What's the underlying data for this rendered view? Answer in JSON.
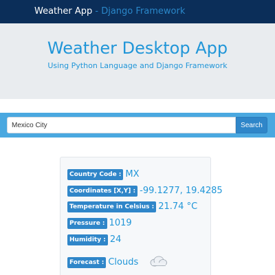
{
  "navbar": {
    "brand_main": "Weather App",
    "brand_sub": " - Django Framework"
  },
  "header": {
    "title": "Weather Desktop App",
    "subtitle": "Using Python Language and Django Framework"
  },
  "search": {
    "value": "Mexico City",
    "button_label": "Search"
  },
  "result": {
    "country_label": "Country Code :",
    "country_value": "MX",
    "coord_label": "Coordinates [X,Y] :",
    "coord_value": "-99.1277, 19.4285",
    "temp_label": "Temperature in Celsius :",
    "temp_value": "21.74 °C",
    "pressure_label": "Pressure :",
    "pressure_value": "1019",
    "humidity_label": "Humidity :",
    "humidity_value": "24",
    "forecast_label": "Forecast :",
    "forecast_value": "Clouds",
    "forecast_icon": "cloud-icon"
  },
  "colors": {
    "navbar": "#0b2e59",
    "accent": "#2196d8",
    "badge": "#2f86c9",
    "search_band": "#4aa8e0",
    "jumbotron": "#e9ecef"
  }
}
